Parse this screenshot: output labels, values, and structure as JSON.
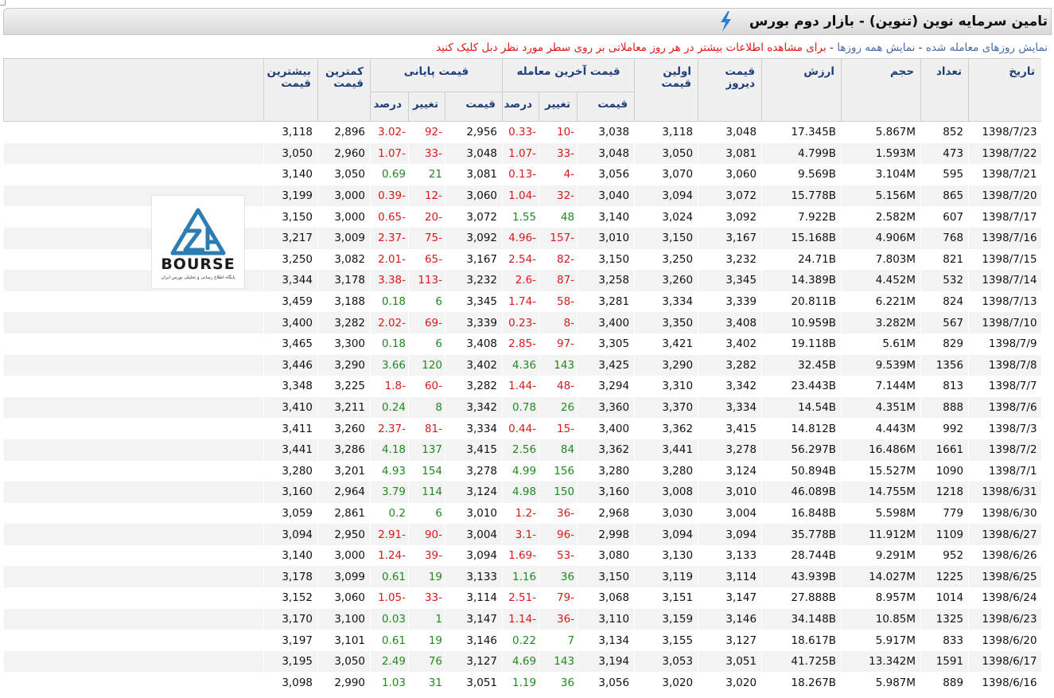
{
  "header": {
    "title": "تامین سرمایه نوین (تنوین) - بازار دوم بورس",
    "accent_color": "#2b7fd6"
  },
  "notice": {
    "link_traded": "نمایش روزهای معامله شده",
    "sep1": " - ",
    "link_all": "نمایش همه روزها",
    "sep2": " - ",
    "instruction": "برای مشاهده اطلاعات بیشتر در هر روز معاملاتی بر روی سطر مورد نظر دبل کلیک کنید"
  },
  "logo": {
    "text": "BOURSE",
    "subtitle": "پایگاه اطلاع رسانی و تحلیلی بورس ایران"
  },
  "table": {
    "headers": {
      "date": "تاریخ",
      "count": "تعداد",
      "volume": "حجم",
      "value": "ارزش",
      "prev_price": "قیمت دیروز",
      "first_price": "اولین قیمت",
      "last_trade_group": "قیمت آخرین معامله",
      "closing_group": "قیمت پایانی",
      "low_price": "کمترین قیمت",
      "high_price": "بیشترین قیمت",
      "sub_price": "قیمت",
      "sub_change": "تغییر",
      "sub_percent": "درصد"
    },
    "rows": [
      {
        "date": "1398/7/23",
        "count": "852",
        "volume": "5.867M",
        "value": "17.345B",
        "prev": "3,048",
        "first": "3,118",
        "last": "3,038",
        "last_chg": "-10",
        "last_pct": "-0.33",
        "close": "2,956",
        "close_chg": "-92",
        "close_pct": "-3.02",
        "low": "2,896",
        "high": "3,118"
      },
      {
        "date": "1398/7/22",
        "count": "473",
        "volume": "1.593M",
        "value": "4.799B",
        "prev": "3,081",
        "first": "3,050",
        "last": "3,048",
        "last_chg": "-33",
        "last_pct": "-1.07",
        "close": "3,048",
        "close_chg": "-33",
        "close_pct": "-1.07",
        "low": "2,960",
        "high": "3,050"
      },
      {
        "date": "1398/7/21",
        "count": "595",
        "volume": "3.104M",
        "value": "9.569B",
        "prev": "3,060",
        "first": "3,070",
        "last": "3,056",
        "last_chg": "-4",
        "last_pct": "-0.13",
        "close": "3,081",
        "close_chg": "21",
        "close_pct": "0.69",
        "low": "3,050",
        "high": "3,140"
      },
      {
        "date": "1398/7/20",
        "count": "865",
        "volume": "5.156M",
        "value": "15.778B",
        "prev": "3,072",
        "first": "3,094",
        "last": "3,040",
        "last_chg": "-32",
        "last_pct": "-1.04",
        "close": "3,060",
        "close_chg": "-12",
        "close_pct": "-0.39",
        "low": "3,000",
        "high": "3,199"
      },
      {
        "date": "1398/7/17",
        "count": "607",
        "volume": "2.582M",
        "value": "7.922B",
        "prev": "3,092",
        "first": "3,024",
        "last": "3,140",
        "last_chg": "48",
        "last_pct": "1.55",
        "close": "3,072",
        "close_chg": "-20",
        "close_pct": "-0.65",
        "low": "3,000",
        "high": "3,150"
      },
      {
        "date": "1398/7/16",
        "count": "768",
        "volume": "4.906M",
        "value": "15.168B",
        "prev": "3,167",
        "first": "3,150",
        "last": "3,010",
        "last_chg": "-157",
        "last_pct": "-4.96",
        "close": "3,092",
        "close_chg": "-75",
        "close_pct": "-2.37",
        "low": "3,009",
        "high": "3,217"
      },
      {
        "date": "1398/7/15",
        "count": "821",
        "volume": "7.803M",
        "value": "24.71B",
        "prev": "3,232",
        "first": "3,250",
        "last": "3,150",
        "last_chg": "-82",
        "last_pct": "-2.54",
        "close": "3,167",
        "close_chg": "-65",
        "close_pct": "-2.01",
        "low": "3,082",
        "high": "3,250"
      },
      {
        "date": "1398/7/14",
        "count": "532",
        "volume": "4.452M",
        "value": "14.389B",
        "prev": "3,345",
        "first": "3,260",
        "last": "3,258",
        "last_chg": "-87",
        "last_pct": "-2.6",
        "close": "3,232",
        "close_chg": "-113",
        "close_pct": "-3.38",
        "low": "3,178",
        "high": "3,344"
      },
      {
        "date": "1398/7/13",
        "count": "824",
        "volume": "6.221M",
        "value": "20.811B",
        "prev": "3,339",
        "first": "3,334",
        "last": "3,281",
        "last_chg": "-58",
        "last_pct": "-1.74",
        "close": "3,345",
        "close_chg": "6",
        "close_pct": "0.18",
        "low": "3,188",
        "high": "3,459"
      },
      {
        "date": "1398/7/10",
        "count": "567",
        "volume": "3.282M",
        "value": "10.959B",
        "prev": "3,408",
        "first": "3,350",
        "last": "3,400",
        "last_chg": "-8",
        "last_pct": "-0.23",
        "close": "3,339",
        "close_chg": "-69",
        "close_pct": "-2.02",
        "low": "3,282",
        "high": "3,400"
      },
      {
        "date": "1398/7/9",
        "count": "829",
        "volume": "5.61M",
        "value": "19.118B",
        "prev": "3,402",
        "first": "3,421",
        "last": "3,305",
        "last_chg": "-97",
        "last_pct": "-2.85",
        "close": "3,408",
        "close_chg": "6",
        "close_pct": "0.18",
        "low": "3,300",
        "high": "3,465"
      },
      {
        "date": "1398/7/8",
        "count": "1356",
        "volume": "9.539M",
        "value": "32.45B",
        "prev": "3,282",
        "first": "3,290",
        "last": "3,425",
        "last_chg": "143",
        "last_pct": "4.36",
        "close": "3,402",
        "close_chg": "120",
        "close_pct": "3.66",
        "low": "3,290",
        "high": "3,446"
      },
      {
        "date": "1398/7/7",
        "count": "813",
        "volume": "7.144M",
        "value": "23.443B",
        "prev": "3,342",
        "first": "3,310",
        "last": "3,294",
        "last_chg": "-48",
        "last_pct": "-1.44",
        "close": "3,282",
        "close_chg": "-60",
        "close_pct": "-1.8",
        "low": "3,225",
        "high": "3,348"
      },
      {
        "date": "1398/7/6",
        "count": "888",
        "volume": "4.351M",
        "value": "14.54B",
        "prev": "3,334",
        "first": "3,370",
        "last": "3,360",
        "last_chg": "26",
        "last_pct": "0.78",
        "close": "3,342",
        "close_chg": "8",
        "close_pct": "0.24",
        "low": "3,211",
        "high": "3,410"
      },
      {
        "date": "1398/7/3",
        "count": "992",
        "volume": "4.443M",
        "value": "14.812B",
        "prev": "3,415",
        "first": "3,362",
        "last": "3,400",
        "last_chg": "-15",
        "last_pct": "-0.44",
        "close": "3,334",
        "close_chg": "-81",
        "close_pct": "-2.37",
        "low": "3,260",
        "high": "3,411"
      },
      {
        "date": "1398/7/2",
        "count": "1661",
        "volume": "16.486M",
        "value": "56.297B",
        "prev": "3,278",
        "first": "3,441",
        "last": "3,362",
        "last_chg": "84",
        "last_pct": "2.56",
        "close": "3,415",
        "close_chg": "137",
        "close_pct": "4.18",
        "low": "3,286",
        "high": "3,441"
      },
      {
        "date": "1398/7/1",
        "count": "1090",
        "volume": "15.527M",
        "value": "50.894B",
        "prev": "3,124",
        "first": "3,280",
        "last": "3,280",
        "last_chg": "156",
        "last_pct": "4.99",
        "close": "3,278",
        "close_chg": "154",
        "close_pct": "4.93",
        "low": "3,201",
        "high": "3,280"
      },
      {
        "date": "1398/6/31",
        "count": "1218",
        "volume": "14.755M",
        "value": "46.089B",
        "prev": "3,010",
        "first": "3,008",
        "last": "3,160",
        "last_chg": "150",
        "last_pct": "4.98",
        "close": "3,124",
        "close_chg": "114",
        "close_pct": "3.79",
        "low": "2,964",
        "high": "3,160"
      },
      {
        "date": "1398/6/30",
        "count": "779",
        "volume": "5.598M",
        "value": "16.848B",
        "prev": "3,004",
        "first": "3,030",
        "last": "2,968",
        "last_chg": "-36",
        "last_pct": "-1.2",
        "close": "3,010",
        "close_chg": "6",
        "close_pct": "0.2",
        "low": "2,861",
        "high": "3,059"
      },
      {
        "date": "1398/6/27",
        "count": "1109",
        "volume": "11.912M",
        "value": "35.778B",
        "prev": "3,094",
        "first": "3,094",
        "last": "2,998",
        "last_chg": "-96",
        "last_pct": "-3.1",
        "close": "3,004",
        "close_chg": "-90",
        "close_pct": "-2.91",
        "low": "2,950",
        "high": "3,094"
      },
      {
        "date": "1398/6/26",
        "count": "952",
        "volume": "9.291M",
        "value": "28.744B",
        "prev": "3,133",
        "first": "3,130",
        "last": "3,080",
        "last_chg": "-53",
        "last_pct": "-1.69",
        "close": "3,094",
        "close_chg": "-39",
        "close_pct": "-1.24",
        "low": "3,000",
        "high": "3,140"
      },
      {
        "date": "1398/6/25",
        "count": "1225",
        "volume": "14.027M",
        "value": "43.939B",
        "prev": "3,114",
        "first": "3,119",
        "last": "3,150",
        "last_chg": "36",
        "last_pct": "1.16",
        "close": "3,133",
        "close_chg": "19",
        "close_pct": "0.61",
        "low": "3,099",
        "high": "3,178"
      },
      {
        "date": "1398/6/24",
        "count": "1014",
        "volume": "8.957M",
        "value": "27.888B",
        "prev": "3,147",
        "first": "3,151",
        "last": "3,068",
        "last_chg": "-79",
        "last_pct": "-2.51",
        "close": "3,114",
        "close_chg": "-33",
        "close_pct": "-1.05",
        "low": "3,060",
        "high": "3,152"
      },
      {
        "date": "1398/6/23",
        "count": "1325",
        "volume": "10.85M",
        "value": "34.148B",
        "prev": "3,146",
        "first": "3,159",
        "last": "3,110",
        "last_chg": "-36",
        "last_pct": "-1.14",
        "close": "3,147",
        "close_chg": "1",
        "close_pct": "0.03",
        "low": "3,100",
        "high": "3,170"
      },
      {
        "date": "1398/6/20",
        "count": "833",
        "volume": "5.917M",
        "value": "18.617B",
        "prev": "3,127",
        "first": "3,155",
        "last": "3,134",
        "last_chg": "7",
        "last_pct": "0.22",
        "close": "3,146",
        "close_chg": "19",
        "close_pct": "0.61",
        "low": "3,101",
        "high": "3,197"
      },
      {
        "date": "1398/6/17",
        "count": "1591",
        "volume": "13.342M",
        "value": "41.725B",
        "prev": "3,051",
        "first": "3,053",
        "last": "3,194",
        "last_chg": "143",
        "last_pct": "4.69",
        "close": "3,127",
        "close_chg": "76",
        "close_pct": "2.49",
        "low": "3,050",
        "high": "3,195"
      },
      {
        "date": "1398/6/16",
        "count": "889",
        "volume": "5.987M",
        "value": "18.267B",
        "prev": "3,020",
        "first": "3,020",
        "last": "3,056",
        "last_chg": "36",
        "last_pct": "1.19",
        "close": "3,051",
        "close_chg": "31",
        "close_pct": "1.03",
        "low": "2,990",
        "high": "3,098"
      }
    ]
  }
}
